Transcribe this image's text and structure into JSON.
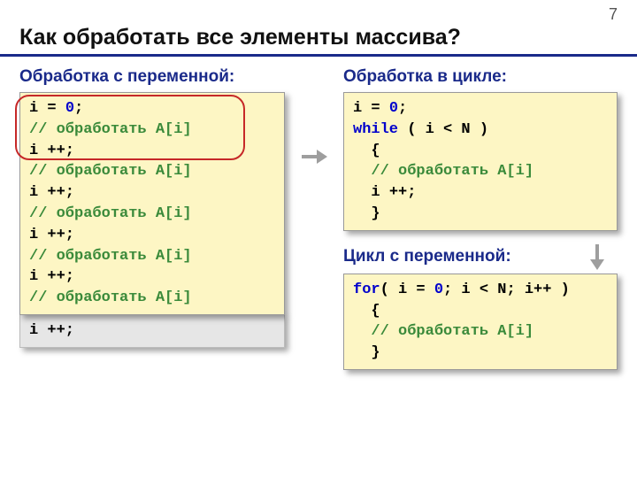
{
  "pageNumber": "7",
  "title": "Как обработать все элементы массива?",
  "left": {
    "heading": "Обработка с переменной:",
    "code": [
      {
        "t": "i "
      },
      {
        "t": "="
      },
      {
        "t": " "
      },
      {
        "t": "0",
        "cls": "lit-blue"
      },
      {
        "t": ";"
      },
      {
        "br": true
      },
      {
        "t": "// обработать A[i]",
        "cls": "comment"
      },
      {
        "br": true
      },
      {
        "t": "i "
      },
      {
        "t": "++;"
      },
      {
        "br": true
      },
      {
        "t": "// обработать A[i]",
        "cls": "comment"
      },
      {
        "br": true
      },
      {
        "t": "i "
      },
      {
        "t": "++;"
      },
      {
        "br": true
      },
      {
        "t": "// обработать A[i]",
        "cls": "comment"
      },
      {
        "br": true
      },
      {
        "t": "i "
      },
      {
        "t": "++;"
      },
      {
        "br": true
      },
      {
        "t": "// обработать A[i]",
        "cls": "comment"
      },
      {
        "br": true
      },
      {
        "t": "i "
      },
      {
        "t": "++;"
      },
      {
        "br": true
      },
      {
        "t": "// обработать A[i]",
        "cls": "comment"
      }
    ],
    "greyCode": "i ++;"
  },
  "right": {
    "heading1": "Обработка в цикле:",
    "code1": [
      {
        "t": "i "
      },
      {
        "t": "="
      },
      {
        "t": " "
      },
      {
        "t": "0",
        "cls": "lit-blue"
      },
      {
        "t": ";"
      },
      {
        "br": true
      },
      {
        "t": "while",
        "cls": "kw-blue"
      },
      {
        "t": " ( i "
      },
      {
        "t": "<"
      },
      {
        "t": " N )"
      },
      {
        "br": true
      },
      {
        "t": "  {"
      },
      {
        "br": true
      },
      {
        "t": "  "
      },
      {
        "t": "// обработать A[i]",
        "cls": "comment"
      },
      {
        "br": true
      },
      {
        "t": "  i "
      },
      {
        "t": "++;"
      },
      {
        "br": true
      },
      {
        "t": "  }"
      }
    ],
    "heading2": "Цикл с переменной:",
    "code2": [
      {
        "t": "for",
        "cls": "kw-blue"
      },
      {
        "t": "( i "
      },
      {
        "t": "="
      },
      {
        "t": " "
      },
      {
        "t": "0",
        "cls": "lit-blue"
      },
      {
        "t": "; i "
      },
      {
        "t": "<"
      },
      {
        "t": " N; i++ )"
      },
      {
        "br": true
      },
      {
        "t": "  {"
      },
      {
        "br": true
      },
      {
        "t": "  "
      },
      {
        "t": "// обработать A[i]",
        "cls": "comment"
      },
      {
        "br": true
      },
      {
        "t": "  }"
      }
    ]
  }
}
